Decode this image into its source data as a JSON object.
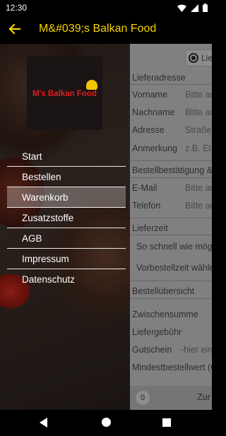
{
  "status_bar": {
    "time": "12:30"
  },
  "app_bar": {
    "title": "M&#039;s Balkan Food"
  },
  "logo": {
    "text": "M's Balkan Food"
  },
  "menu": {
    "items": [
      {
        "label": "Start",
        "active": false
      },
      {
        "label": "Bestellen",
        "active": false
      },
      {
        "label": "Warenkorb",
        "active": true
      },
      {
        "label": "Zusatzstoffe",
        "active": false
      },
      {
        "label": "AGB",
        "active": false
      },
      {
        "label": "Impressum",
        "active": false
      },
      {
        "label": "Datenschutz",
        "active": false
      }
    ]
  },
  "form": {
    "delivery_option": "Liefe",
    "address_title": "Lieferadresse",
    "fields": {
      "vorname": {
        "label": "Vorname",
        "placeholder": "Bitte an"
      },
      "nachname": {
        "label": "Nachname",
        "placeholder": "Bitte an"
      },
      "adresse": {
        "label": "Adresse",
        "placeholder": "Straße"
      },
      "anmerkung": {
        "label": "Anmerkung",
        "placeholder": "z.B. Eta"
      },
      "email": {
        "label": "E-Mail",
        "placeholder": "Bitte an"
      },
      "telefon": {
        "label": "Telefon",
        "placeholder": "Bitte an"
      },
      "gutschein": {
        "label": "Gutschein",
        "placeholder": "-hier ein"
      }
    },
    "confirmation_title": "Bestellbestätigung &",
    "time_title": "Lieferzeit",
    "time_options": [
      "So schnell wie mögl",
      "Vorbestellzeit wähle"
    ],
    "overview_title": "Bestellübersicht",
    "subtotal_label": "Zwischensumme",
    "delivery_fee_label": "Liefergebühr",
    "min_order_label": "Mindestbestellwert (C",
    "bottom": {
      "count": "0",
      "label": "Zur"
    }
  }
}
